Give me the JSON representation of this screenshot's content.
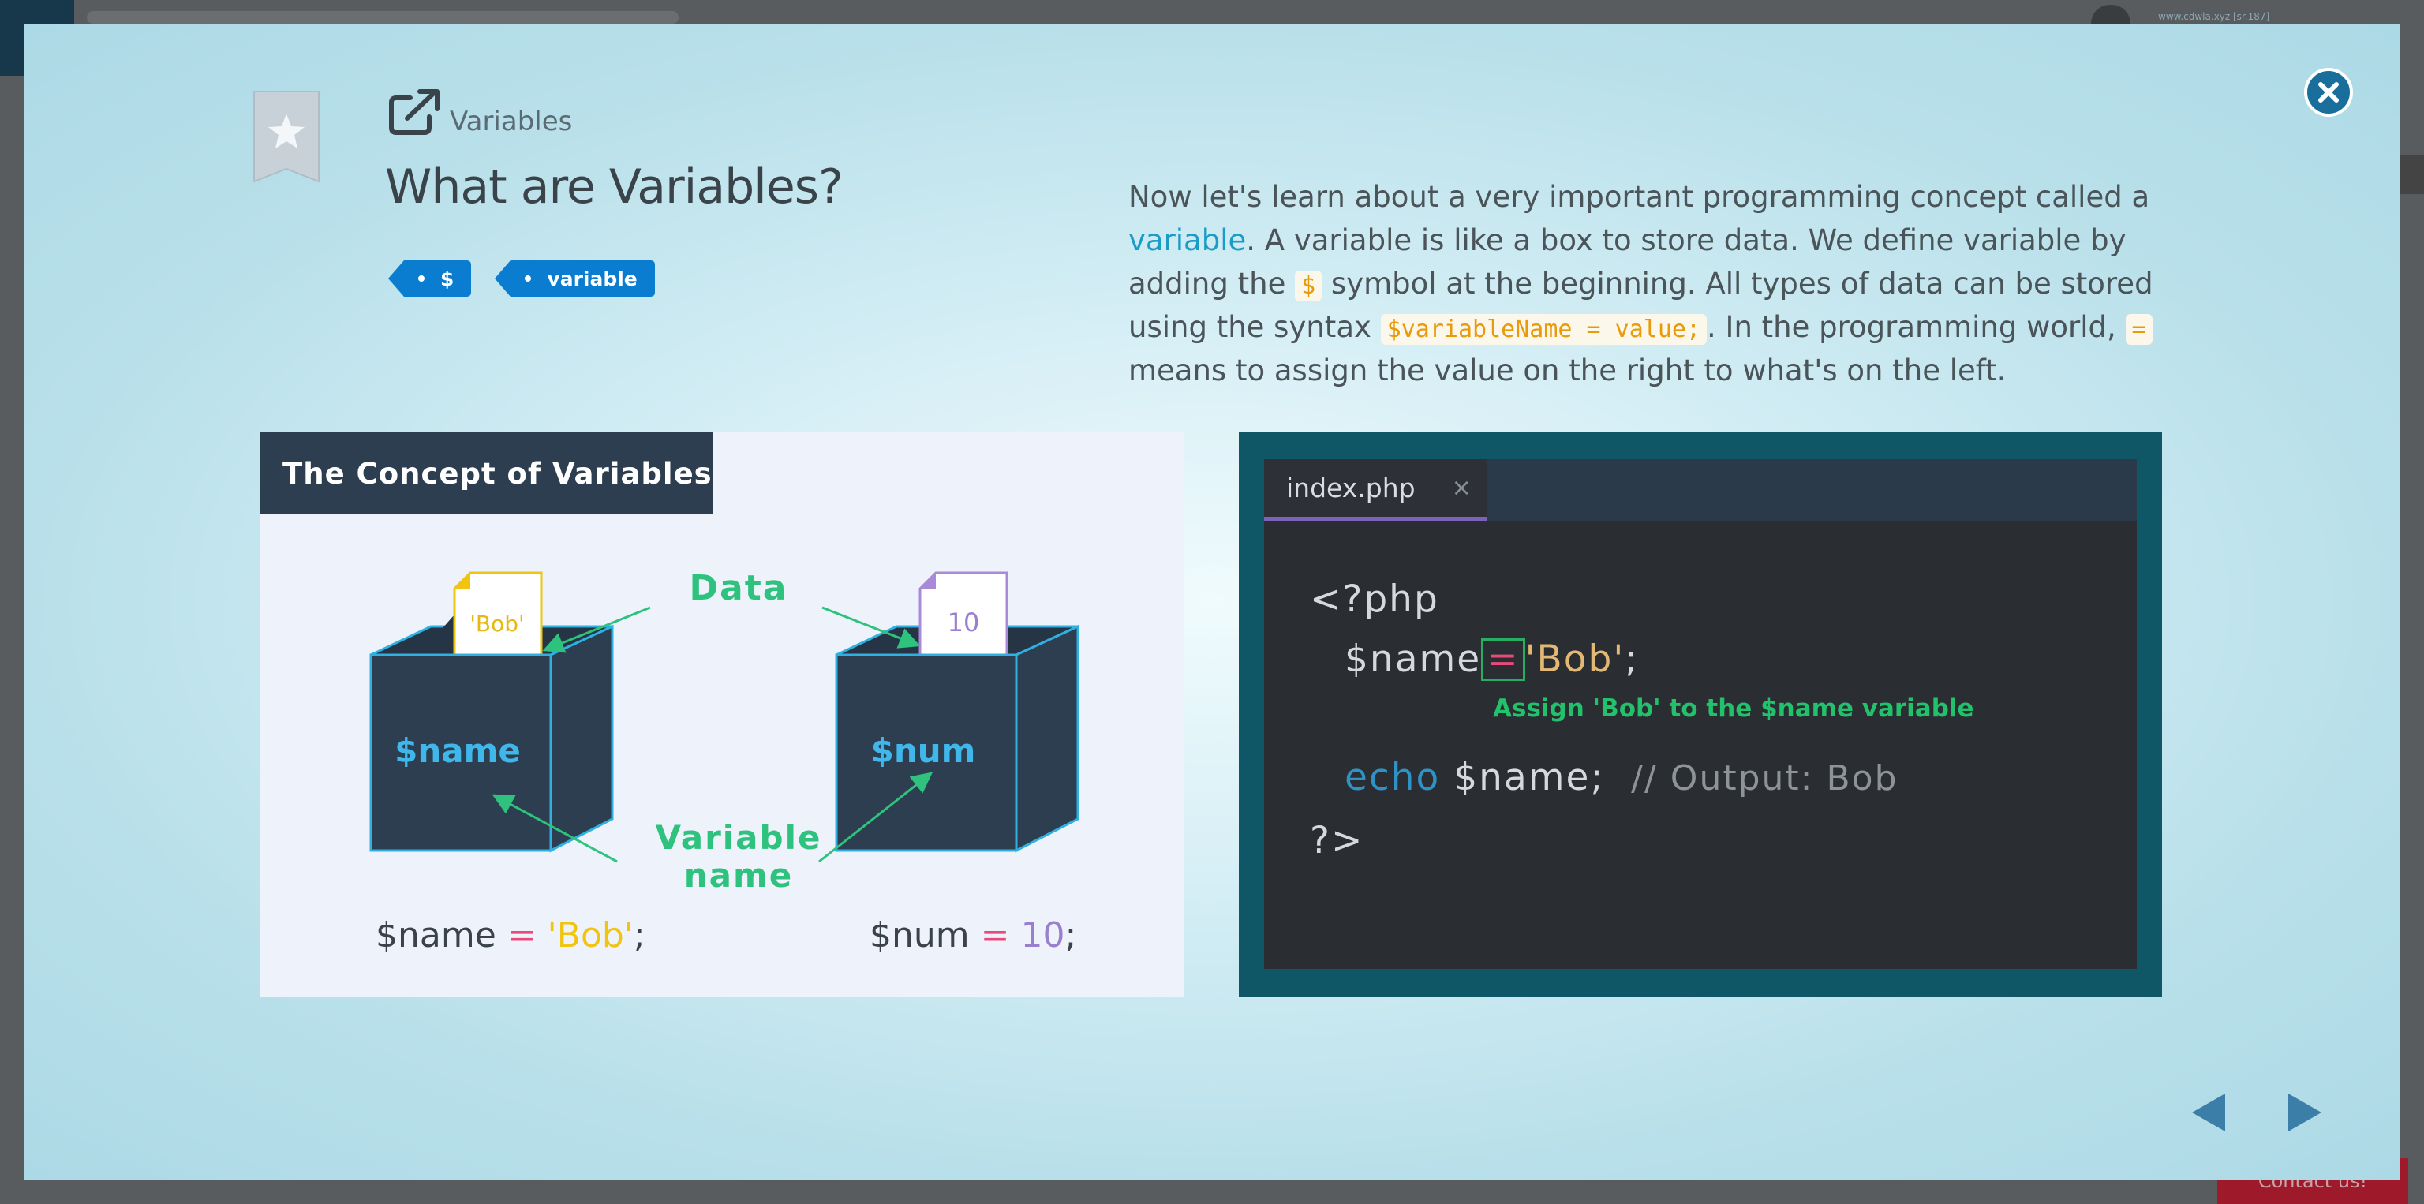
{
  "background": {
    "url_text": "www.cdwla.xyz [sr.187]",
    "contact_label": "Contact us!"
  },
  "header": {
    "category": "Variables",
    "title": "What are Variables?",
    "tags": [
      "$",
      "variable"
    ]
  },
  "description": {
    "part1": "Now let's learn about a very important programming concept called a ",
    "highlight": "variable",
    "part2": ". A variable is like a box to store data. We define variable by adding the ",
    "code1": "$",
    "part3": " symbol at the beginning. All types of data can be stored using the syntax ",
    "code2": "$variableName = value;",
    "part4": ". In the programming world, ",
    "code3": "=",
    "part5": " means to assign the value on the right to what's on the left."
  },
  "diagram": {
    "title": "The Concept of Variables",
    "data_label": "Data",
    "var_label_line1": "Variable",
    "var_label_line2": "name",
    "box1_value": "'Bob'",
    "box1_name": "$name",
    "box2_value": "10",
    "box2_name": "$num",
    "expr1": {
      "var": "$name",
      "op": "=",
      "value": "'Bob'",
      "end": ";"
    },
    "expr2": {
      "var": "$num",
      "op": "=",
      "value": "10",
      "end": ";"
    }
  },
  "editor": {
    "filename": "index.php",
    "close_symbol": "×",
    "line1": "<?php",
    "line2_var": "$name",
    "line2_op": "=",
    "line2_str": "'Bob'",
    "line2_end": ";",
    "annotation": "Assign 'Bob' to the $name variable",
    "line3_kw": "echo",
    "line3_rest": " $name;",
    "line3_comment": "// Output: Bob",
    "line4": "?>"
  },
  "colors": {
    "accent": "#0a7dd0",
    "highlight_text": "#1a9cc7",
    "green": "#22c16b",
    "editor_bg": "#2a2d31",
    "frame_teal": "#0f5766",
    "box_navy": "#2c3e50"
  },
  "icons": [
    "bookmark-star-icon",
    "external-link-icon",
    "close-icon",
    "prev-arrow-icon",
    "next-arrow-icon"
  ]
}
